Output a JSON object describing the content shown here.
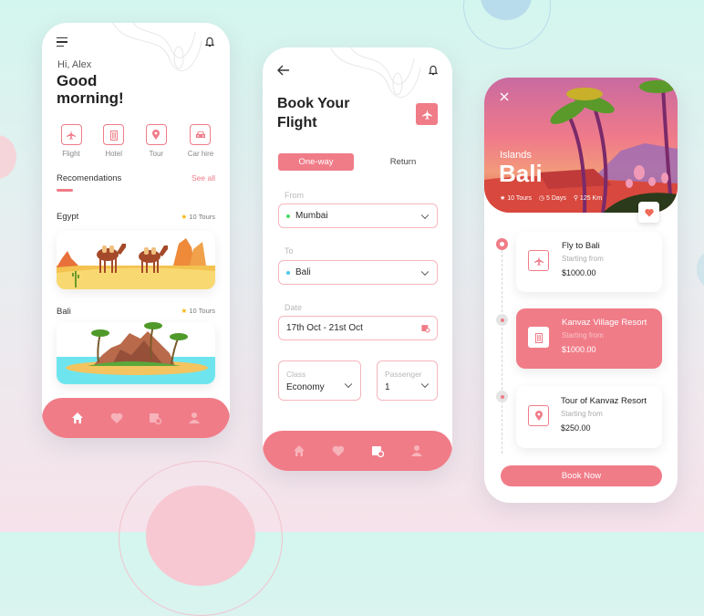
{
  "colors": {
    "accent": "#f07c88",
    "dark": "#2a2a2a",
    "muted": "#9a9a9a",
    "star": "#f5b400",
    "from_dot": "#4cd964",
    "to_dot": "#4cc6e8"
  },
  "home": {
    "greeting": "Hi, Alex",
    "title_line1": "Good",
    "title_line2": "morning!",
    "categories": [
      {
        "label": "Flight",
        "icon": "plane-icon"
      },
      {
        "label": "Hotel",
        "icon": "hotel-icon"
      },
      {
        "label": "Tour",
        "icon": "map-pin-icon"
      },
      {
        "label": "Car hire",
        "icon": "car-icon"
      }
    ],
    "section_title": "Recomendations",
    "see_all": "See all",
    "destinations": [
      {
        "name": "Egypt",
        "tours": "10 Tours"
      },
      {
        "name": "Bali",
        "tours": "10 Tours"
      }
    ],
    "nav": [
      "home-icon",
      "heart-icon",
      "calendar-icon",
      "user-icon"
    ],
    "nav_active": 0
  },
  "booking": {
    "title_line1": "Book Your",
    "title_line2": "Flight",
    "trip_types": [
      "One-way",
      "Return"
    ],
    "active_trip_type": "One-way",
    "from_label": "From",
    "from_value": "Mumbai",
    "to_label": "To",
    "to_value": "Bali",
    "date_label": "Date",
    "date_value": "17th Oct - 21st Oct",
    "class_label": "Class",
    "class_value": "Economy",
    "passenger_label": "Passenger",
    "passenger_value": "1",
    "nav_active": 2
  },
  "detail": {
    "subtitle": "Islands",
    "title": "Bali",
    "tours": "10 Tours",
    "days": "5 Days",
    "distance": "125 Km",
    "items": [
      {
        "title": "Fly to Bali",
        "caption": "Starting from",
        "price": "$1000.00",
        "icon": "plane-icon",
        "highlight": false
      },
      {
        "title": "Kanvaz Village Resort",
        "caption": "Starting from",
        "price": "$1000.00",
        "icon": "hotel-icon",
        "highlight": true
      },
      {
        "title": "Tour of Kanvaz Resort",
        "caption": "Starting from",
        "price": "$250.00",
        "icon": "map-pin-icon",
        "highlight": false
      }
    ],
    "book_button": "Book Now"
  }
}
